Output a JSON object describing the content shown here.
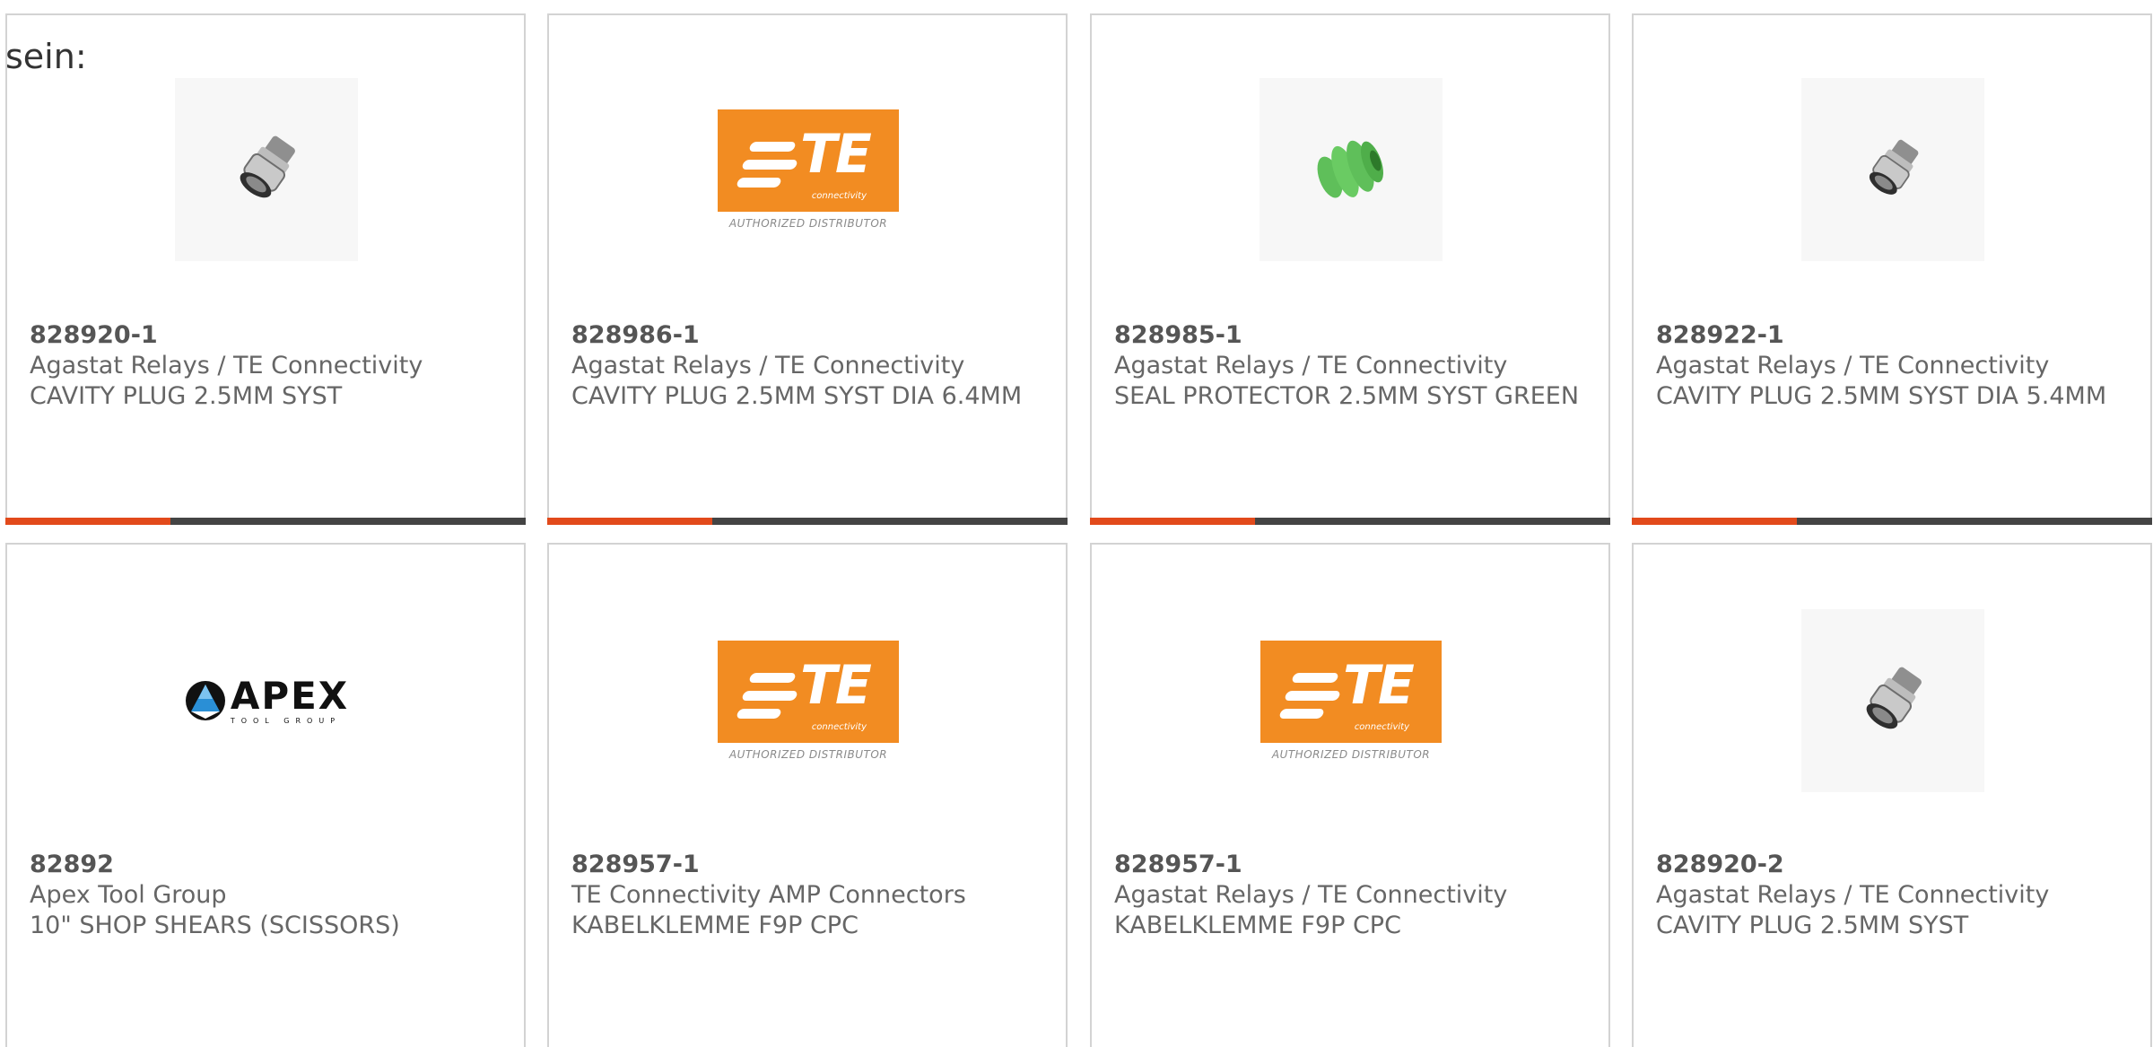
{
  "lead_text": "sein:",
  "products": [
    {
      "part_number": "828920-1",
      "manufacturer": "Agastat Relays / TE Connectivity",
      "description": "CAVITY PLUG 2.5MM SYST",
      "image": "cavity-plug-photo"
    },
    {
      "part_number": "828986-1",
      "manufacturer": "Agastat Relays / TE Connectivity",
      "description": "CAVITY PLUG 2.5MM SYST DIA 6.4MM",
      "image": "te-connectivity-logo"
    },
    {
      "part_number": "828985-1",
      "manufacturer": "Agastat Relays / TE Connectivity",
      "description": "SEAL PROTECTOR 2.5MM SYST GREEN",
      "image": "green-seal-photo"
    },
    {
      "part_number": "828922-1",
      "manufacturer": "Agastat Relays / TE Connectivity",
      "description": "CAVITY PLUG 2.5MM SYST DIA 5.4MM",
      "image": "cavity-plug-photo"
    },
    {
      "part_number": "82892",
      "manufacturer": "Apex Tool Group",
      "description": "10\" SHOP SHEARS (SCISSORS)",
      "image": "apex-tool-group-logo"
    },
    {
      "part_number": "828957-1",
      "manufacturer": "TE Connectivity AMP Connectors",
      "description": "KABELKLEMME F9P CPC",
      "image": "te-connectivity-logo"
    },
    {
      "part_number": "828957-1",
      "manufacturer": "Agastat Relays / TE Connectivity",
      "description": "KABELKLEMME F9P CPC",
      "image": "te-connectivity-logo"
    },
    {
      "part_number": "828920-2",
      "manufacturer": "Agastat Relays / TE Connectivity",
      "description": "CAVITY PLUG 2.5MM SYST",
      "image": "cavity-plug-photo"
    }
  ],
  "te_logo": {
    "letters": "TE",
    "sub": "connectivity",
    "distributor": "AUTHORIZED DISTRIBUTOR"
  },
  "apex_logo": {
    "main": "APEX",
    "sub": "TOOL GROUP"
  },
  "colors": {
    "accent": "#e24a1b",
    "bar": "#444444",
    "te_orange": "#f28c22",
    "border": "#d3d3d3"
  }
}
